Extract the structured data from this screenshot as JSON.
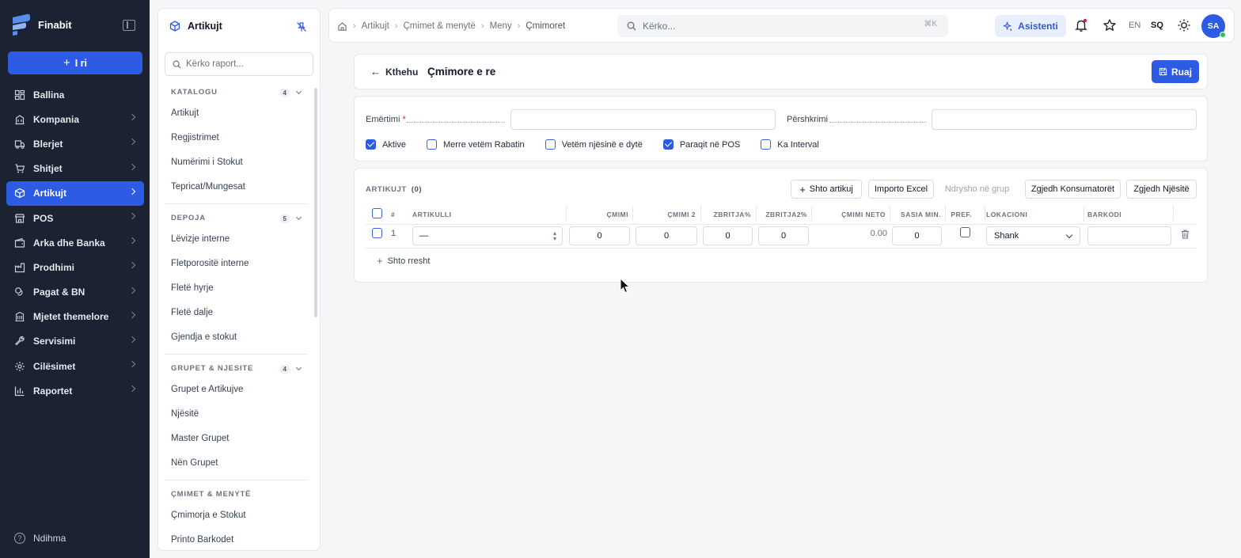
{
  "app": {
    "name": "Finabit",
    "new_label": "I ri",
    "help_label": "Ndihma"
  },
  "nav": [
    {
      "label": "Ballina",
      "icon": "dashboard-icon",
      "chevron": false,
      "active": false
    },
    {
      "label": "Kompania",
      "icon": "building-icon",
      "chevron": true,
      "active": false
    },
    {
      "label": "Blerjet",
      "icon": "truck-icon",
      "chevron": true,
      "active": false
    },
    {
      "label": "Shitjet",
      "icon": "cart-icon",
      "chevron": true,
      "active": false
    },
    {
      "label": "Artikujt",
      "icon": "box-icon",
      "chevron": true,
      "active": true
    },
    {
      "label": "POS",
      "icon": "store-icon",
      "chevron": true,
      "active": false
    },
    {
      "label": "Arka dhe Banka",
      "icon": "wallet-icon",
      "chevron": true,
      "active": false
    },
    {
      "label": "Prodhimi",
      "icon": "factory-icon",
      "chevron": true,
      "active": false
    },
    {
      "label": "Pagat & BN",
      "icon": "coins-icon",
      "chevron": true,
      "active": false
    },
    {
      "label": "Mjetet themelore",
      "icon": "asset-icon",
      "chevron": true,
      "active": false
    },
    {
      "label": "Servisimi",
      "icon": "wrench-icon",
      "chevron": true,
      "active": false
    },
    {
      "label": "Cilësimet",
      "icon": "gear-icon",
      "chevron": true,
      "active": false
    },
    {
      "label": "Raportet",
      "icon": "bar-chart-icon",
      "chevron": true,
      "active": false
    }
  ],
  "panel": {
    "title": "Artikujt",
    "search_placeholder": "Kërko raport...",
    "sections": [
      {
        "title": "KATALOGU",
        "count": "4",
        "items": [
          "Artikujt",
          "Regjistrimet",
          "Numërimi i Stokut",
          "Tepricat/Mungesat"
        ]
      },
      {
        "title": "DEPOJA",
        "count": "5",
        "items": [
          "Lëvizje interne",
          "Fletporositë interne",
          "Fletë hyrje",
          "Fletë dalje",
          "Gjendja e stokut"
        ]
      },
      {
        "title": "GRUPET & NJESITE",
        "count": "4",
        "items": [
          "Grupet e Artikujve",
          "Njësitë",
          "Master Grupet",
          "Nën Grupet"
        ]
      },
      {
        "title": "ÇMIMET & MENYTË",
        "count": "",
        "items": [
          "Çmimorja e Stokut",
          "Printo Barkodet"
        ]
      }
    ]
  },
  "topbar": {
    "breadcrumbs": [
      "Artikujt",
      "Çmimet & menytë",
      "Meny",
      "Çmimoret"
    ],
    "search_placeholder": "Kërko...",
    "shortcut": "⌘K",
    "assistant_label": "Asistenti",
    "lang_en": "EN",
    "lang_sq": "SQ",
    "avatar_initials": "SA"
  },
  "header": {
    "back_label": "Kthehu",
    "title": "Çmimore e re",
    "save_label": "Ruaj"
  },
  "form": {
    "name_label": "Emërtimi",
    "required_mark": "*",
    "name_value": "",
    "desc_label": "Përshkrimi",
    "desc_value": "",
    "checks": [
      {
        "label": "Aktive",
        "checked": true
      },
      {
        "label": "Merre vetëm Rabatin",
        "checked": false
      },
      {
        "label": "Vetëm njësinë e dytë",
        "checked": false
      },
      {
        "label": "Paraqit në POS",
        "checked": true
      },
      {
        "label": "Ka Interval",
        "checked": false
      }
    ]
  },
  "items": {
    "title": "ARTIKUJT",
    "count": "(0)",
    "buttons": {
      "add": "Shto artikuj",
      "import": "Importo Excel",
      "group": "Ndrysho në grup",
      "consumers": "Zgjedh Konsumatorët",
      "units": "Zgjedh Njësitë"
    },
    "columns": [
      "#",
      "ARTIKULLI",
      "ÇMIMI",
      "ÇMIMI 2",
      "ZBRITJA%",
      "ZBRITJA2%",
      "ÇMIMI NETO",
      "SASIA MIN.",
      "PREF.",
      "LOKACIONI",
      "BARKODI"
    ],
    "row": {
      "num": "1",
      "article": "—",
      "price": "0",
      "price2": "0",
      "disc": "0",
      "disc2": "0",
      "neto": "0.00",
      "min_qty": "0",
      "pref": false,
      "location": "Shank",
      "barcode": ""
    },
    "add_row_label": "Shto rresht"
  },
  "colors": {
    "accent": "#2d5be3",
    "sidebar": "#1b2333",
    "danger": "#e11d48"
  }
}
